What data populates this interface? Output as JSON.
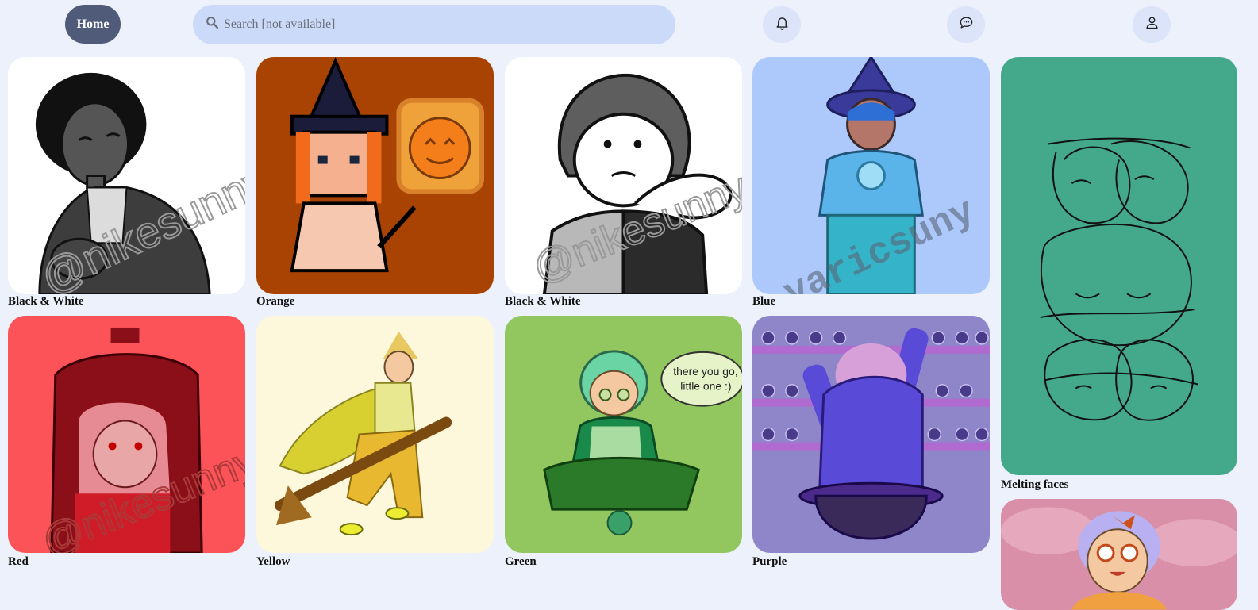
{
  "header": {
    "home_label": "Home",
    "search_placeholder": "Search [not available]",
    "icons": {
      "search": "magnifier-icon",
      "notifications": "bell-icon",
      "messages": "chat-bubble-icon",
      "profile": "user-icon"
    }
  },
  "colors": {
    "page_bg": "#edf1fb",
    "home_btn": "#4f5b78",
    "search_bg": "#ccdafa",
    "icon_btn_bg": "#dbe4f9"
  },
  "gallery": [
    {
      "caption": "Black & White",
      "bg": "#ffffff"
    },
    {
      "caption": "Orange",
      "bg": "#a84303"
    },
    {
      "caption": "Black & White",
      "bg": "#ffffff"
    },
    {
      "caption": "Blue",
      "bg": "#adc9fb"
    },
    {
      "caption": "Melting faces",
      "bg": "#44a98a"
    },
    {
      "caption": "Red",
      "bg": "#fc5358"
    },
    {
      "caption": "Yellow",
      "bg": "#fdf7dc"
    },
    {
      "caption": "Green",
      "bg": "#92c65e"
    },
    {
      "caption": "Purple",
      "bg": "#8f86c9"
    },
    {
      "caption": "",
      "bg": "#d98fa8"
    }
  ],
  "artwork_text": {
    "speech_bubble": "there you go, little one :)"
  }
}
